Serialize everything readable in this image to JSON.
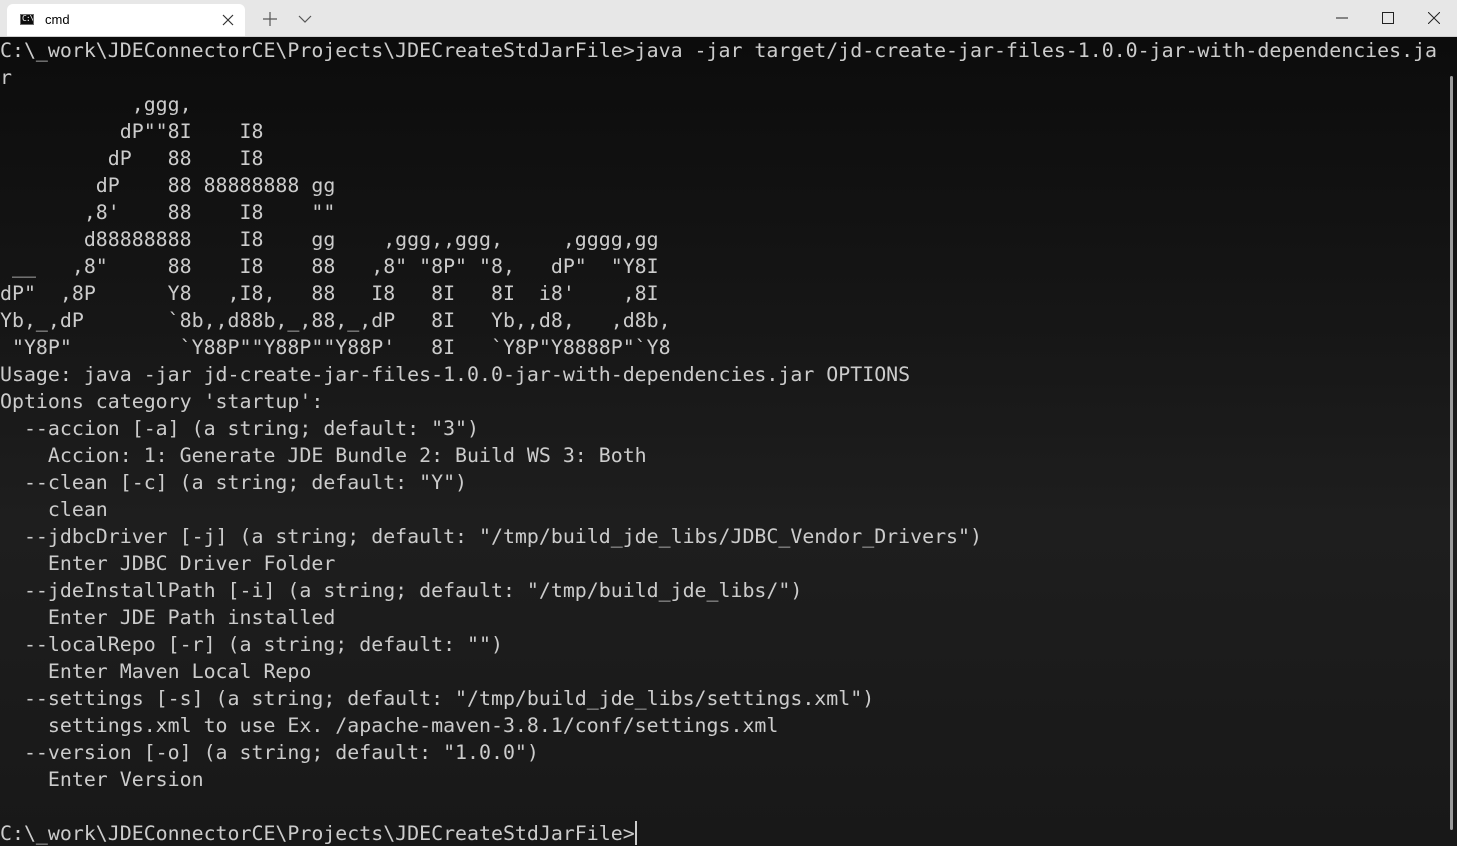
{
  "window": {
    "tab_title": "cmd",
    "tab_icon_text": "C:\\",
    "accent_color": "#e7e7e7",
    "terminal_background": "#0c0c0c",
    "terminal_foreground": "#cccccc"
  },
  "icons": {
    "tab_icon": "console-icon",
    "tab_close": "close-icon",
    "new_tab": "plus-icon",
    "dropdown": "chevron-down-icon",
    "minimize": "minimize-icon",
    "maximize": "maximize-icon",
    "close": "close-icon"
  },
  "terminal": {
    "lines": [
      "C:\\_work\\JDEConnectorCE\\Projects\\JDECreateStdJarFile>java -jar target/jd-create-jar-files-1.0.0-jar-with-dependencies.ja",
      "r",
      "           ,ggg,",
      "          dP\"\"8I    I8",
      "         dP   88    I8",
      "        dP    88 88888888 gg",
      "       ,8'    88    I8    \"\"",
      "       d88888888    I8    gg    ,ggg,,ggg,     ,gggg,gg",
      " __   ,8\"     88    I8    88   ,8\" \"8P\" \"8,   dP\"  \"Y8I",
      "dP\"  ,8P      Y8   ,I8,   88   I8   8I   8I  i8'    ,8I",
      "Yb,_,dP       `8b,,d88b,_,88,_,dP   8I   Yb,,d8,   ,d8b,",
      " \"Y8P\"         `Y88P\"\"Y88P\"\"Y88P'   8I   `Y8P\"Y8888P\"`Y8",
      "Usage: java -jar jd-create-jar-files-1.0.0-jar-with-dependencies.jar OPTIONS",
      "Options category 'startup':",
      "  --accion [-a] (a string; default: \"3\")",
      "    Accion: 1: Generate JDE Bundle 2: Build WS 3: Both",
      "  --clean [-c] (a string; default: \"Y\")",
      "    clean",
      "  --jdbcDriver [-j] (a string; default: \"/tmp/build_jde_libs/JDBC_Vendor_Drivers\")",
      "    Enter JDBC Driver Folder",
      "  --jdeInstallPath [-i] (a string; default: \"/tmp/build_jde_libs/\")",
      "    Enter JDE Path installed",
      "  --localRepo [-r] (a string; default: \"\")",
      "    Enter Maven Local Repo",
      "  --settings [-s] (a string; default: \"/tmp/build_jde_libs/settings.xml\")",
      "    settings.xml to use Ex. /apache-maven-3.8.1/conf/settings.xml",
      "  --version [-o] (a string; default: \"1.0.0\")",
      "    Enter Version",
      "",
      "C:\\_work\\JDEConnectorCE\\Projects\\JDECreateStdJarFile>"
    ]
  }
}
